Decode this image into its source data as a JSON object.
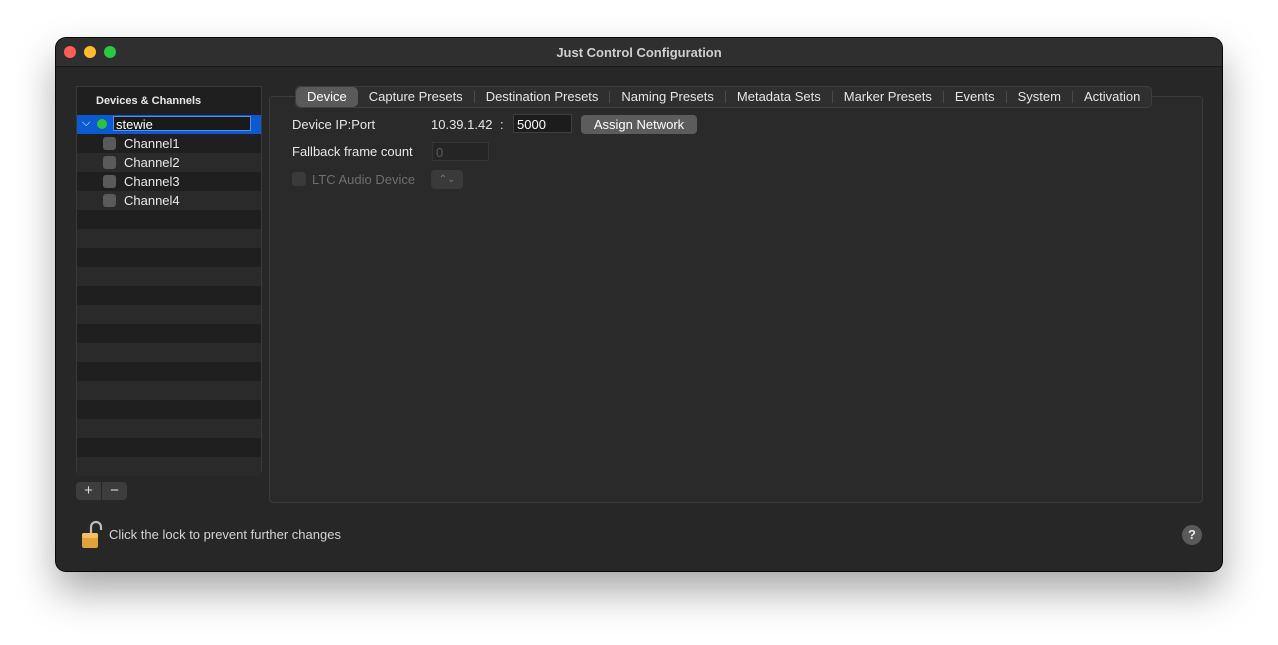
{
  "window": {
    "title": "Just Control Configuration"
  },
  "sidebar": {
    "header": "Devices & Channels",
    "device": {
      "name": "stewie",
      "status_color": "#2ec13f"
    },
    "channels": [
      "Channel1",
      "Channel2",
      "Channel3",
      "Channel4"
    ],
    "add_label": "+",
    "remove_label": "−"
  },
  "tabs": [
    "Device",
    "Capture Presets",
    "Destination Presets",
    "Naming Presets",
    "Metadata Sets",
    "Marker Presets",
    "Events",
    "System",
    "Activation"
  ],
  "active_tab": "Device",
  "device_tab": {
    "ip_port_label": "Device IP:Port",
    "ip": "10.39.1.42",
    "colon": ":",
    "port": "5000",
    "assign_button": "Assign Network",
    "fallback_label": "Fallback frame count",
    "fallback_placeholder": "0",
    "ltc_label": "LTC Audio Device",
    "ltc_popup_glyph": "⌃⌄"
  },
  "footer": {
    "lock_text": "Click the lock to prevent further changes",
    "help_label": "?"
  }
}
